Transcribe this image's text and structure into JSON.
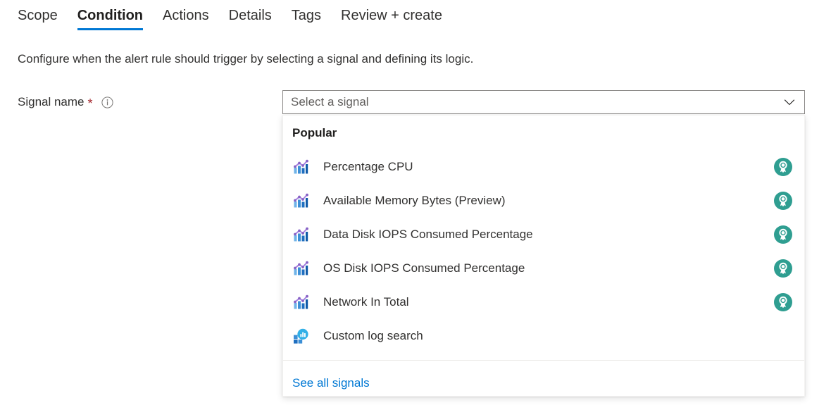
{
  "tabs": [
    {
      "label": "Scope",
      "active": false
    },
    {
      "label": "Condition",
      "active": true
    },
    {
      "label": "Actions",
      "active": false
    },
    {
      "label": "Details",
      "active": false
    },
    {
      "label": "Tags",
      "active": false
    },
    {
      "label": "Review + create",
      "active": false
    }
  ],
  "description": "Configure when the alert rule should trigger by selecting a signal and defining its logic.",
  "field": {
    "label": "Signal name",
    "required_marker": "*",
    "info_icon": "info-circle-icon"
  },
  "combobox": {
    "placeholder": "Select a signal",
    "value": "",
    "chevron_icon": "chevron-down-icon",
    "expanded": true
  },
  "dropdown": {
    "group_header": "Popular",
    "options": [
      {
        "label": "Percentage CPU",
        "icon": "metric-chart-icon",
        "badge": "popular-award-badge-icon",
        "has_badge": true
      },
      {
        "label": "Available Memory Bytes (Preview)",
        "icon": "metric-chart-icon",
        "badge": "popular-award-badge-icon",
        "has_badge": true
      },
      {
        "label": "Data Disk IOPS Consumed Percentage",
        "icon": "metric-chart-icon",
        "badge": "popular-award-badge-icon",
        "has_badge": true
      },
      {
        "label": "OS Disk IOPS Consumed Percentage",
        "icon": "metric-chart-icon",
        "badge": "popular-award-badge-icon",
        "has_badge": true
      },
      {
        "label": "Network In Total",
        "icon": "metric-chart-icon",
        "badge": "popular-award-badge-icon",
        "has_badge": true
      },
      {
        "label": "Custom log search",
        "icon": "log-search-icon",
        "badge": "",
        "has_badge": false
      }
    ],
    "see_all_link": "See all signals"
  },
  "colors": {
    "accent_blue": "#0078d4",
    "link_blue": "#0078d4",
    "required_red": "#a4262c",
    "badge_teal": "#2f9e91",
    "text_primary": "#323130",
    "placeholder_gray": "#605e5c",
    "border_gray": "#8a8886",
    "metric_icon_purple": "#8661c5",
    "metric_icon_blue": "#0078d4",
    "log_icon_cyan": "#32b0e7"
  }
}
